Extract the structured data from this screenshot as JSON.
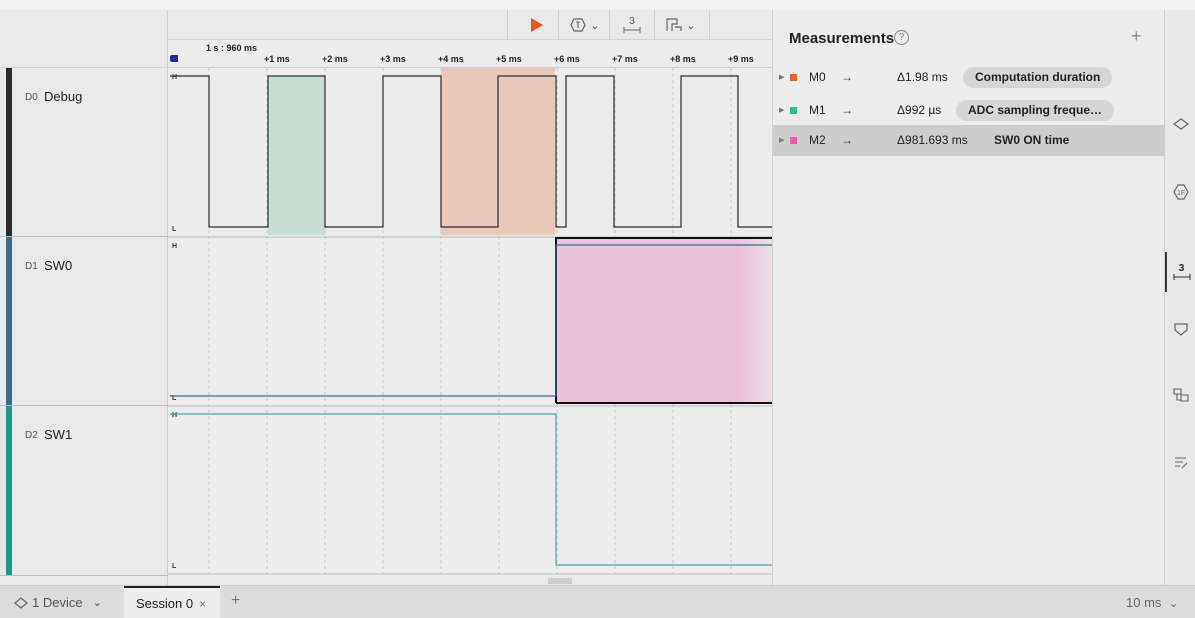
{
  "toolbar": {
    "play_icon": "play-icon",
    "trigger_icon": "trigger-icon",
    "measure_icon": "measure-icon",
    "marker_icon": "marker-icon",
    "measure_glyph": "3"
  },
  "ruler": {
    "origin": "1 s : 960 ms",
    "ticks": [
      "+1 ms",
      "+2 ms",
      "+3 ms",
      "+4 ms",
      "+5 ms",
      "+6 ms",
      "+7 ms",
      "+8 ms",
      "+9 ms"
    ]
  },
  "channels": [
    {
      "id": "D0",
      "name": "Debug",
      "color": "#2a2a2a"
    },
    {
      "id": "D1",
      "name": "SW0",
      "color": "#3c6b8a"
    },
    {
      "id": "D2",
      "name": "SW1",
      "color": "#1f9a89"
    }
  ],
  "levels": {
    "high": "H",
    "low": "L"
  },
  "measurements": {
    "title": "Measurements",
    "help": "?",
    "add": "+",
    "items": [
      {
        "id": "M0",
        "delta": "Δ1.98 ms",
        "name": "Computation duration",
        "color": "#e2602c"
      },
      {
        "id": "M1",
        "delta": "Δ992 µs",
        "name": "ADC sampling freque…",
        "color": "#2fbf86"
      },
      {
        "id": "M2",
        "delta": "Δ981.693 ms",
        "name": "SW0 ON time",
        "color": "#e85fa8"
      }
    ]
  },
  "sidebar_icons": [
    "layers-icon",
    "trigger-icon",
    "measure-icon",
    "filter-icon",
    "marker-icon",
    "notes-icon"
  ],
  "sidebar_measure_glyph": "3",
  "bottom": {
    "device": "1 Device",
    "session": "Session 0",
    "session_close": "×",
    "add_tab": "+",
    "zoom": "10 ms"
  },
  "colors": {
    "debug_trace": "#2a2a2a",
    "sw0_trace": "#3c6b8a",
    "sw1_trace": "#4aa8b0",
    "m0_fill": "#e8c9bc",
    "m1_fill": "#c7dfd2",
    "m2_fill": "#ebc2dc"
  }
}
